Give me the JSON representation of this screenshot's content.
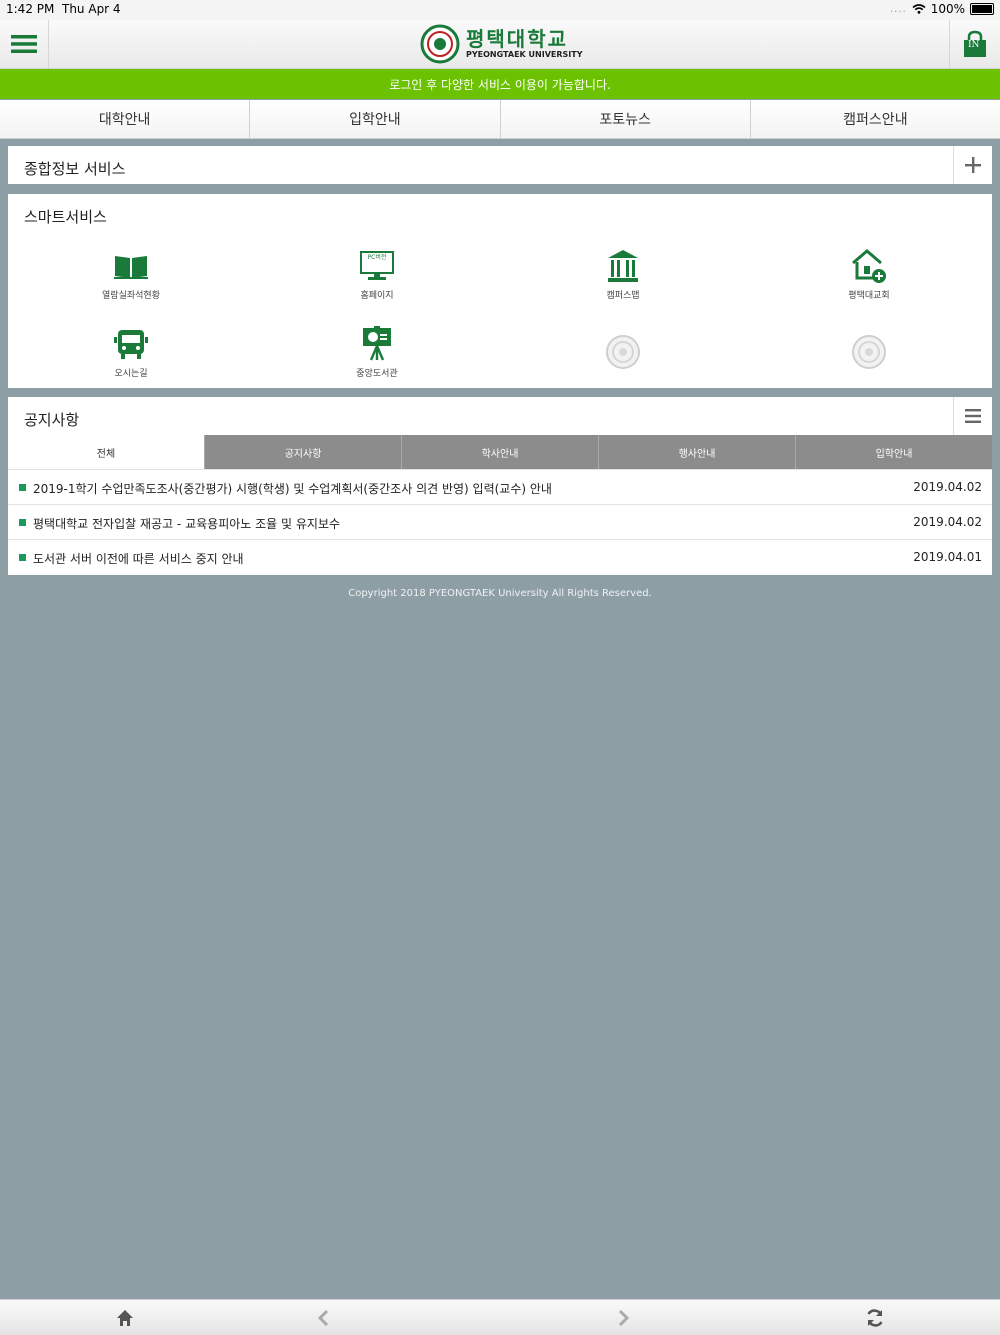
{
  "status_bar": {
    "time": "1:42 PM",
    "date": "Thu Apr 4",
    "signal": "....",
    "battery": "100%"
  },
  "header": {
    "logo_korean": "평택대학교",
    "logo_english": "PYEONGTAEK UNIVERSITY",
    "login_label": "IN",
    "accent_color": "#1a7a3a"
  },
  "banner": {
    "text": "로그인 후 다양한 서비스 이용이 가능합니다.",
    "color": "#6cc200"
  },
  "top_nav": [
    "대학안내",
    "입학안내",
    "포토뉴스",
    "캠퍼스안내"
  ],
  "info_panel": {
    "title": "종합정보 서비스"
  },
  "smart_panel": {
    "title": "스마트서비스",
    "items": [
      {
        "label": "열람실좌석현황",
        "icon": "book-icon"
      },
      {
        "label": "홈페이지",
        "icon": "monitor-icon",
        "icon_text": "PC버전"
      },
      {
        "label": "캠퍼스맵",
        "icon": "building-icon"
      },
      {
        "label": "평택대교회",
        "icon": "church-icon"
      },
      {
        "label": "오시는길",
        "icon": "bus-icon"
      },
      {
        "label": "중앙도서관",
        "icon": "presentation-icon"
      },
      {
        "label": "",
        "icon": "university-seal-icon"
      },
      {
        "label": "",
        "icon": "university-seal-icon"
      }
    ]
  },
  "notice_panel": {
    "title": "공지사항",
    "tabs": [
      "전체",
      "공지사항",
      "학사안내",
      "행사안내",
      "입학안내"
    ],
    "items": [
      {
        "title": "2019-1학기 수업만족도조사(중간평가) 시행(학생) 및 수업계획서(중간조사 의견 반영) 입력(교수) 안내",
        "date": "2019.04.02"
      },
      {
        "title": "평택대학교 전자입찰 재공고 - 교육용피아노 조율 및 유지보수",
        "date": "2019.04.02"
      },
      {
        "title": "도서관 서버 이전에 따른 서비스 중지 안내",
        "date": "2019.04.01"
      }
    ]
  },
  "footer": {
    "copyright": "Copyright 2018 PYEONGTAEK University All Rights Reserved."
  },
  "bottom_bar": [
    "home-icon",
    "back-icon",
    "forward-icon",
    "refresh-icon"
  ]
}
